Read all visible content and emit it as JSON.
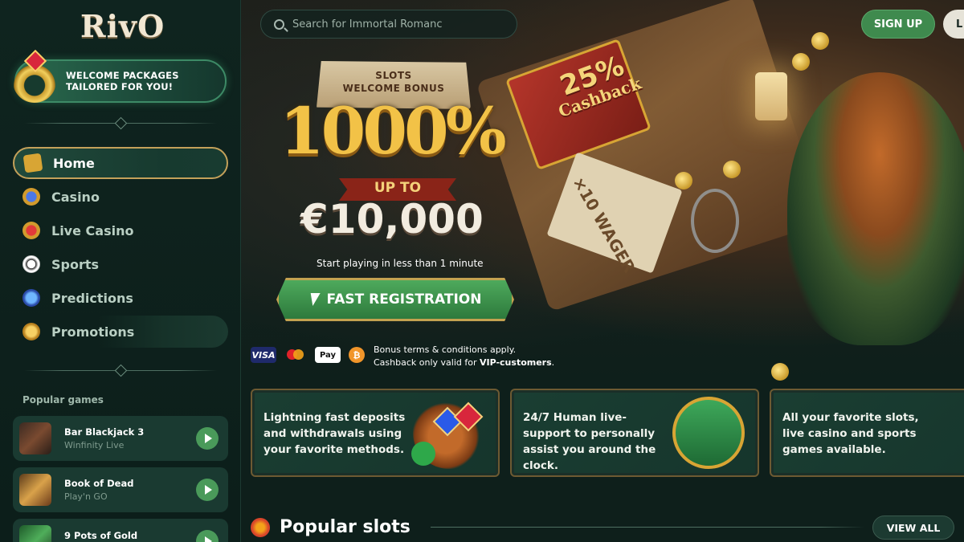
{
  "brand": {
    "logo": "RivO"
  },
  "sidebar": {
    "welcome": {
      "line1": "WELCOME PACKAGES",
      "line2": "TAILORED FOR YOU!"
    },
    "nav": [
      {
        "label": "Home",
        "icon": "treasure-map-icon",
        "active": true
      },
      {
        "label": "Casino",
        "icon": "casino-gem-icon",
        "active": false
      },
      {
        "label": "Live Casino",
        "icon": "live-gem-icon",
        "active": false
      },
      {
        "label": "Sports",
        "icon": "soccer-ball-icon",
        "active": false
      },
      {
        "label": "Predictions",
        "icon": "crystal-ball-icon",
        "active": false
      },
      {
        "label": "Promotions",
        "icon": "crown-coin-icon",
        "active": false
      }
    ],
    "popular_games_label": "Popular games",
    "games": [
      {
        "title": "Bar Blackjack 3",
        "provider": "Winfinity Live"
      },
      {
        "title": "Book of Dead",
        "provider": "Play'n GO"
      },
      {
        "title": "9 Pots of Gold",
        "provider": ""
      }
    ]
  },
  "header": {
    "search_placeholder": "Search for Immortal Romanc",
    "signup": "SIGN UP",
    "login": "L"
  },
  "hero": {
    "sign_line1": "SLOTS",
    "sign_line2": "WELCOME BONUS",
    "percent": "1000%",
    "up_to": "UP TO",
    "amount": "€10,000",
    "start_text": "Start playing in less than 1 minute",
    "cta": "FAST REGISTRATION",
    "book_cashback_pct": "25%",
    "book_cashback_word": "Cashback",
    "wager": "×10 WAGER",
    "terms_line1": "Bonus terms & conditions apply.",
    "terms_line2_prefix": "Cashback only valid for ",
    "terms_line2_bold": "VIP-customers",
    "terms_line2_suffix": ".",
    "payments": [
      "VISA",
      "Mastercard",
      "Apple Pay",
      "Bitcoin"
    ],
    "pay_apple_label": "Pay",
    "pay_btc_label": "₿"
  },
  "features": [
    {
      "text": "Lightning fast deposits and withdrawals using your favorite methods.",
      "icon": "treasure-bag-icon"
    },
    {
      "text": "24/7 Human live-support to personally assist you around the clock.",
      "icon": "support-shield-icon"
    },
    {
      "text": "All your favorite slots, live casino and sports games available.",
      "icon": "slot-machine-icon"
    }
  ],
  "popular_slots": {
    "title": "Popular slots",
    "view_all": "VIEW ALL"
  },
  "colors": {
    "accent_green": "#3f8a4e",
    "gold": "#d8a534",
    "bg": "#0e1f1b"
  }
}
